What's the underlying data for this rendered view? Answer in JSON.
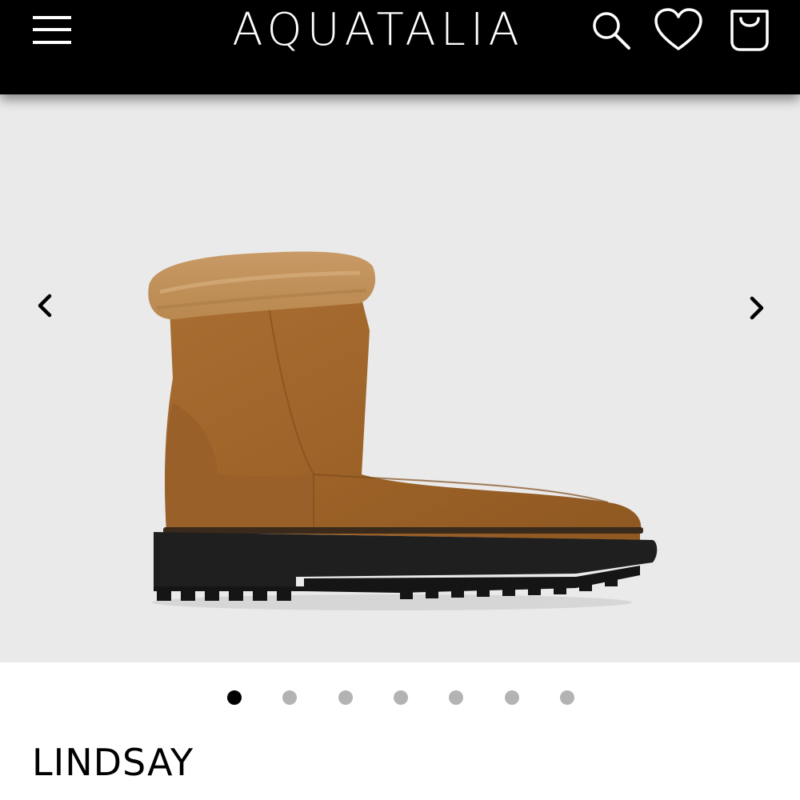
{
  "header": {
    "brand": "AQUATALIA",
    "icons": {
      "menu": "hamburger-menu-icon",
      "search": "search-icon",
      "wishlist": "heart-icon",
      "bag": "shopping-bag-icon"
    }
  },
  "gallery": {
    "image": "suede-ankle-boot-with-faux-fur-collar",
    "prev_icon": "chevron-left-icon",
    "next_icon": "chevron-right-icon",
    "slide_count": 7,
    "active_slide": 1,
    "background": "#eaeaea"
  },
  "product": {
    "name": "LINDSAY"
  },
  "colors": {
    "header_bg": "#000000",
    "dot_active": "#000000",
    "dot_inactive": "#b3b3b3"
  }
}
